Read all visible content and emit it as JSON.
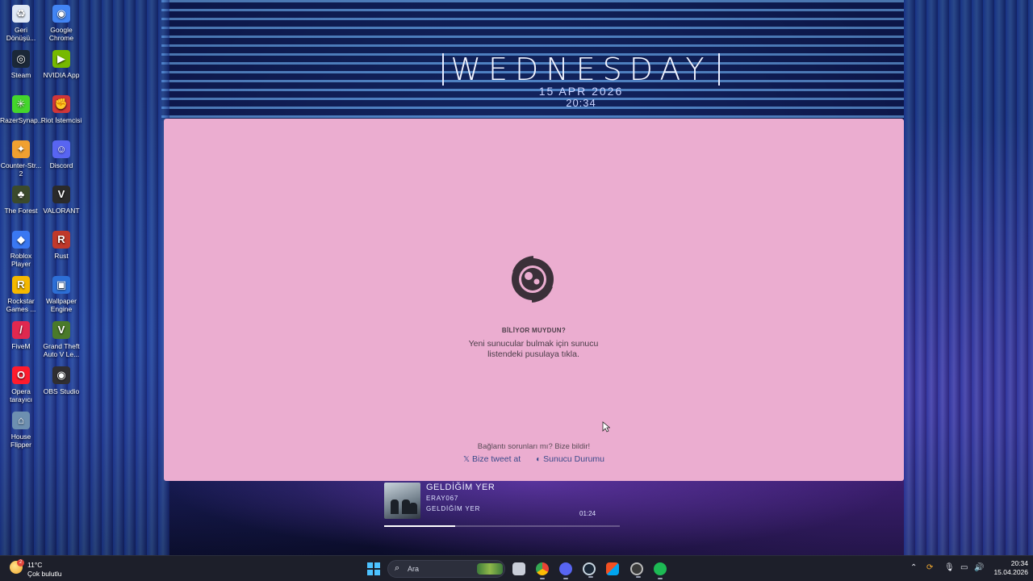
{
  "clock_widget": {
    "day": "WEDNESDAY",
    "date": "15 APR 2026",
    "time": "20:34"
  },
  "desktop_icons": [
    {
      "label": "Geri Dönüşü...",
      "icon": "recycle-bin-icon",
      "color": "#dfe8f5"
    },
    {
      "label": "Google Chrome",
      "icon": "chrome-icon",
      "color": "#4285f4"
    },
    {
      "label": "Steam",
      "icon": "steam-icon",
      "color": "#1b2838"
    },
    {
      "label": "NVIDIA App",
      "icon": "nvidia-icon",
      "color": "#76b900"
    },
    {
      "label": "RazerSynap...",
      "icon": "razer-icon",
      "color": "#44d62c"
    },
    {
      "label": "Riot İstemcisi",
      "icon": "riot-icon",
      "color": "#d13639"
    },
    {
      "label": "Counter-Str... 2",
      "icon": "counter-strike-icon",
      "color": "#f0a030"
    },
    {
      "label": "Discord",
      "icon": "discord-icon",
      "color": "#5865f2"
    },
    {
      "label": "The Forest",
      "icon": "the-forest-icon",
      "color": "#3b4a2c"
    },
    {
      "label": "VALORANT",
      "icon": "valorant-icon",
      "color": "#2a2a2a"
    },
    {
      "label": "Roblox Player",
      "icon": "roblox-icon",
      "color": "#3a78f2"
    },
    {
      "label": "Rust",
      "icon": "rust-icon",
      "color": "#c0392b"
    },
    {
      "label": "Rockstar Games ...",
      "icon": "rockstar-icon",
      "color": "#f5b800"
    },
    {
      "label": "Wallpaper Engine",
      "icon": "wallpaper-engine-icon",
      "color": "#2d6fd6"
    },
    {
      "label": "FiveM",
      "icon": "fivem-icon",
      "color": "#e0284f"
    },
    {
      "label": "Grand Theft Auto V Le...",
      "icon": "gta-v-icon",
      "color": "#4a7a2a"
    },
    {
      "label": "Opera tarayıcı",
      "icon": "opera-icon",
      "color": "#ff1b2d"
    },
    {
      "label": "OBS Studio",
      "icon": "obs-icon",
      "color": "#302e31"
    },
    {
      "label": "House Flipper",
      "icon": "house-flipper-icon",
      "color": "#6d8fb0"
    }
  ],
  "launcher": {
    "background": "#ebadd0",
    "tip_title": "BİLİYOR MUYDUN?",
    "tip_text": "Yeni sunucular bulmak için sunucu listendeki pusulaya tıkla.",
    "connection_text": "Bağlantı sorunları mı? Bize bildir!",
    "tweet_link": "Bize tweet at",
    "status_link": "Sunucu Durumu"
  },
  "music_widget": {
    "title": "GELDİĞİM YER",
    "artist": "ERAY067",
    "album": "GELDİĞİM YER",
    "time": "01:24",
    "progress": 0.3
  },
  "taskbar": {
    "weather_temp": "11°C",
    "weather_condition": "Çok bulutlu",
    "weather_badge": "2",
    "search_placeholder": "Ara",
    "clock_time": "20:34",
    "clock_date": "15.04.2026",
    "accent": "#4cc2ff"
  }
}
